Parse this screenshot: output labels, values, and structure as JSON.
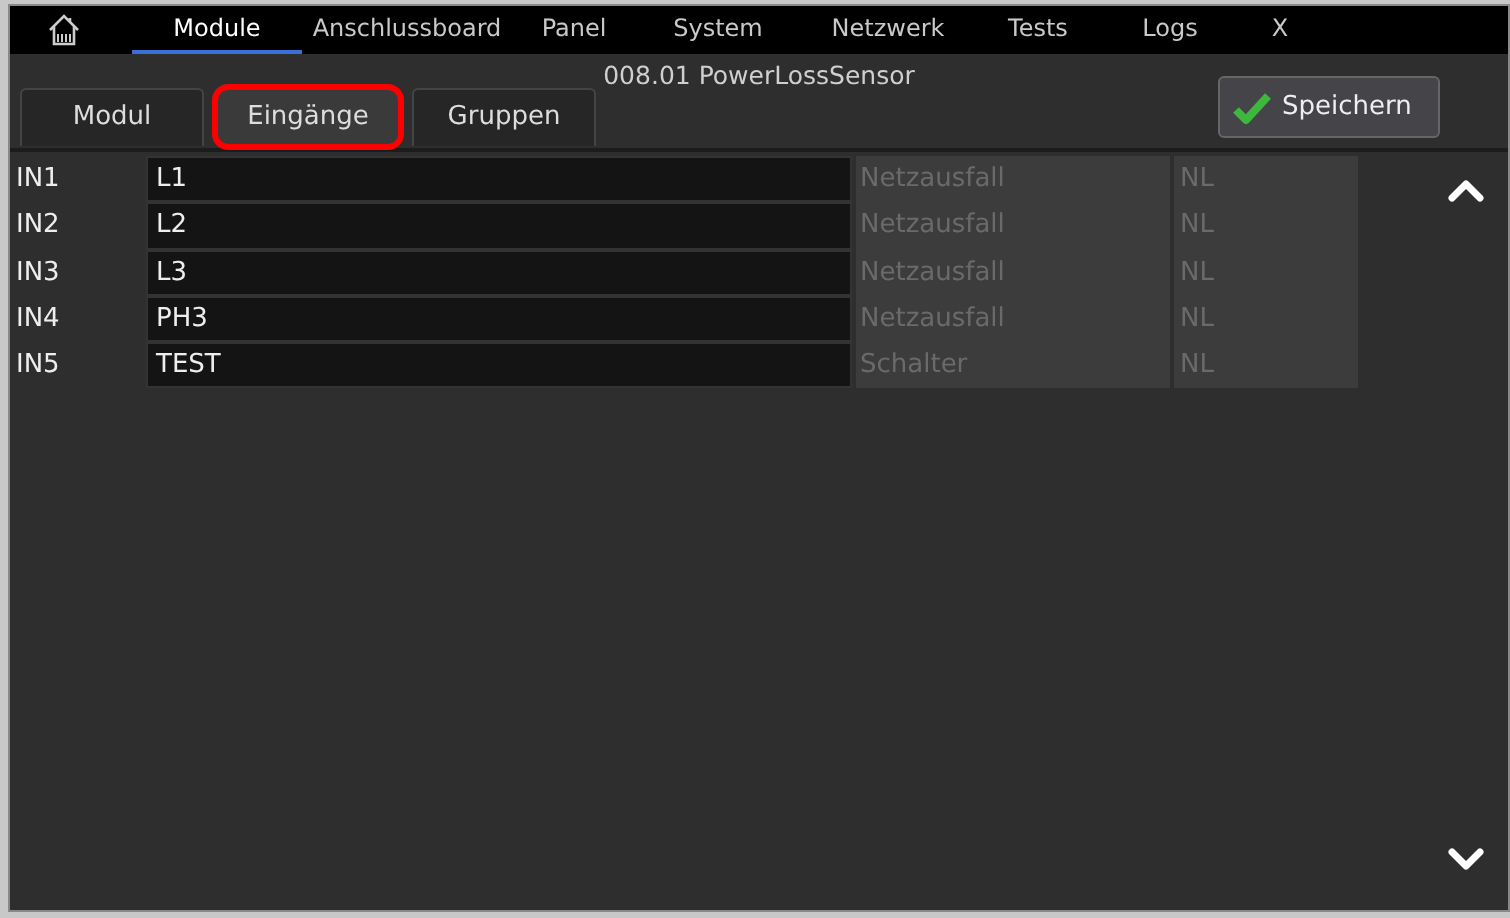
{
  "nav": {
    "tabs": [
      {
        "label": "Module",
        "selected": true
      },
      {
        "label": "Anschlussboard",
        "selected": false
      },
      {
        "label": "Panel",
        "selected": false
      },
      {
        "label": "System",
        "selected": false
      },
      {
        "label": "Netzwerk",
        "selected": false
      },
      {
        "label": "Tests",
        "selected": false
      },
      {
        "label": "Logs",
        "selected": false
      }
    ],
    "close": "X"
  },
  "title": "008.01 PowerLossSensor",
  "subtabs": [
    {
      "label": "Modul",
      "selected": false,
      "highlighted": false
    },
    {
      "label": "Eingänge",
      "selected": true,
      "highlighted": true
    },
    {
      "label": "Gruppen",
      "selected": false,
      "highlighted": false
    }
  ],
  "save_button": "Speichern",
  "rows": [
    {
      "input": "IN1",
      "name": "L1",
      "column_3": "Netzausfall",
      "column_4": "NL"
    },
    {
      "input": "IN2",
      "name": "L2",
      "column_3": "Netzausfall",
      "column_4": "NL"
    },
    {
      "input": "IN3",
      "name": "L3",
      "column_3": "Netzausfall",
      "column_4": "NL"
    },
    {
      "input": "IN4",
      "name": "PH3",
      "column_3": "Netzausfall",
      "column_4": "NL"
    },
    {
      "input": "IN5",
      "name": "TEST",
      "column_3": "Schalter",
      "column_4": "NL"
    }
  ]
}
